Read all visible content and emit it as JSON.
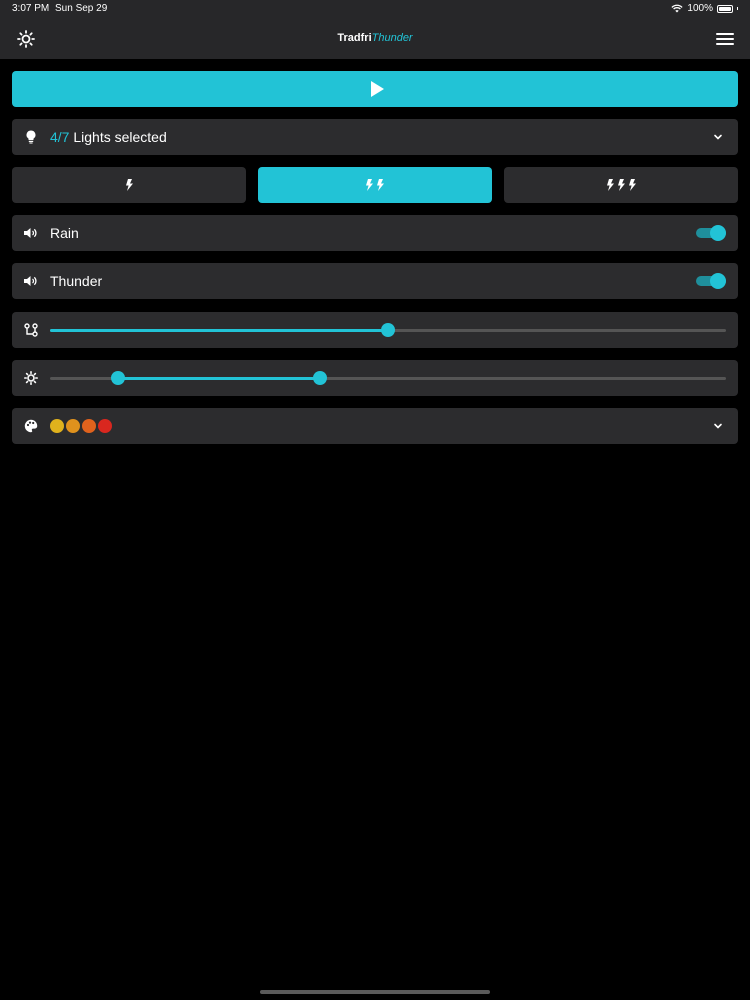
{
  "status_bar": {
    "time": "3:07 PM",
    "date": "Sun Sep 29",
    "battery": "100%",
    "battery_level": 1.0,
    "wifi_icon": "wifi-icon"
  },
  "header": {
    "title_main": "Tradfri",
    "title_accent": "Thunder",
    "left_icon": "brightness-icon",
    "right_icon": "menu-icon"
  },
  "colors": {
    "accent": "#22c3d6",
    "panel": "#2c2c2e",
    "background": "#000000"
  },
  "play": {
    "icon": "play-icon"
  },
  "lights": {
    "selected": "4/7",
    "label": "Lights selected",
    "icon": "lightbulb-icon"
  },
  "intensity": {
    "options": [
      {
        "bolts": 1,
        "icon": "lightning-icon",
        "selected": false
      },
      {
        "bolts": 2,
        "icon": "lightning-icon",
        "selected": true
      },
      {
        "bolts": 3,
        "icon": "lightning-icon",
        "selected": false
      }
    ]
  },
  "sounds": [
    {
      "label": "Rain",
      "enabled": true,
      "icon": "volume-icon"
    },
    {
      "label": "Thunder",
      "enabled": true,
      "icon": "volume-icon"
    }
  ],
  "frequency_slider": {
    "icon": "flow-icon",
    "value": 0.5
  },
  "brightness_slider": {
    "icon": "sun-icon",
    "low": 0.1,
    "high": 0.4
  },
  "palette": {
    "icon": "palette-icon",
    "colors": [
      "#e0b21d",
      "#e0921d",
      "#e0621d",
      "#d9271f"
    ]
  }
}
